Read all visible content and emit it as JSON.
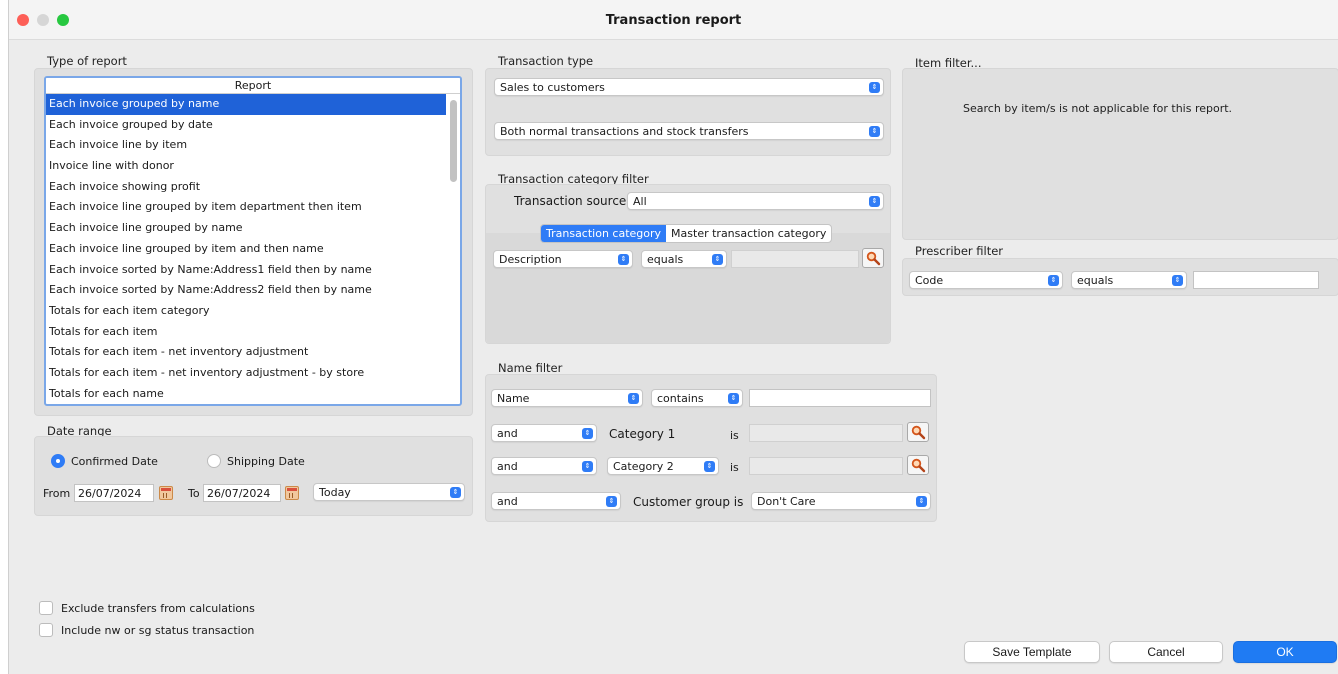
{
  "window": {
    "title": "Transaction report",
    "traffic_colors": {
      "close": "#fd5f57",
      "minimize": "#d6d6d6",
      "maximize": "#27c840"
    }
  },
  "type_of_report": {
    "label": "Type of report",
    "column_header": "Report",
    "selected_index": 0,
    "items": [
      "Each invoice grouped by name",
      "Each invoice grouped by date",
      "Each invoice line by item",
      "Invoice line with donor",
      "Each invoice showing profit",
      "Each invoice line grouped by item department then item",
      "Each invoice line grouped by name",
      "Each invoice line grouped by item and then name",
      "Each invoice sorted by Name:Address1 field then by name",
      "Each invoice sorted by Name:Address2 field then by name",
      "Totals for each item category",
      "Totals for each item",
      "Totals for each item - net inventory adjustment",
      "Totals for each item - net inventory adjustment - by store",
      "Totals for each name"
    ]
  },
  "date_range": {
    "label": "Date range",
    "confirmed_label": "Confirmed Date",
    "shipping_label": "Shipping Date",
    "selected": "confirmed",
    "from_label": "From",
    "from_value": "26/07/2024",
    "to_label": "To",
    "to_value": "26/07/2024",
    "preset": "Today"
  },
  "transaction_type": {
    "label": "Transaction type",
    "type_value": "Sales to customers",
    "scope_value": "Both normal transactions and stock transfers"
  },
  "category_filter": {
    "label": "Transaction category filter",
    "source_label": "Transaction source",
    "source_value": "All",
    "tabs": [
      "Transaction category",
      "Master transaction category"
    ],
    "active_tab": 0,
    "field_value": "Description",
    "operator_value": "equals",
    "value": ""
  },
  "item_filter": {
    "label": "Item filter...",
    "message": "Search by item/s is not applicable for this report."
  },
  "prescriber_filter": {
    "label": "Prescriber filter",
    "field_value": "Code",
    "operator_value": "equals",
    "value": ""
  },
  "name_filter": {
    "label": "Name filter",
    "row1": {
      "field": "Name",
      "operator": "contains",
      "value": ""
    },
    "row2": {
      "conjunction": "and",
      "field_label": "Category 1",
      "is_label": "is",
      "value": ""
    },
    "row3": {
      "conjunction": "and",
      "field": "Category 2",
      "is_label": "is",
      "value": ""
    },
    "row4": {
      "conjunction": "and",
      "field_label": "Customer group is",
      "value": "Don't Care"
    }
  },
  "options": {
    "exclude_transfers": {
      "label": "Exclude transfers from calculations",
      "checked": false
    },
    "include_nw_sg": {
      "label": "Include nw or sg status transaction",
      "checked": false
    }
  },
  "buttons": {
    "save_template": "Save Template",
    "cancel": "Cancel",
    "ok": "OK"
  },
  "colors": {
    "accent": "#2f7cf6",
    "selection": "#1f62d8"
  },
  "icons": {
    "lookup": "magnifier-icon",
    "calendar": "calendar-icon",
    "popup_arrows": "updown-arrows-icon"
  }
}
